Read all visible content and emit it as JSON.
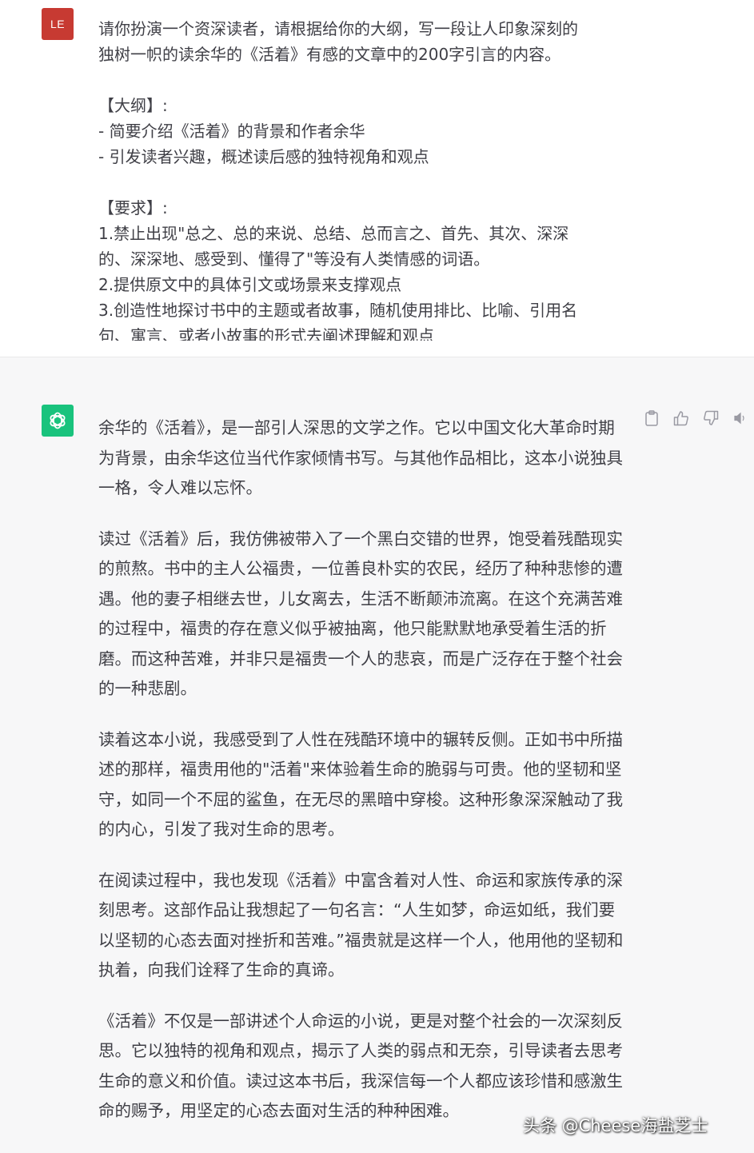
{
  "user_message": {
    "avatar_initials": "LE",
    "lines": [
      "请你扮演一个资深读者，请根据给你的大纲，写一段让人印象深刻的",
      "独树一帜的读余华的《活着》有感的文章中的200字引言的内容。",
      "",
      "【大纲】:",
      "- 简要介绍《活着》的背景和作者余华",
      "- 引发读者兴趣，概述读后感的独特视角和观点",
      "",
      "【要求】:",
      "1.禁止出现\"总之、总的来说、总结、总而言之、首先、其次、深深",
      "的、深深地、感受到、懂得了\"等没有人类情感的词语。",
      "2.提供原文中的具体引文或场景来支撑观点",
      "3.创造性地探讨书中的主题或者故事，随机使用排比、比喻、引用名",
      "句、寓言、或者小故事的形式去阐述理解和观点"
    ]
  },
  "assistant_message": {
    "avatar_icon": "openai-logo-icon",
    "paragraphs": [
      "余华的《活着》，是一部引人深思的文学之作。它以中国文化大革命时期为背景，由余华这位当代作家倾情书写。与其他作品相比，这本小说独具一格，令人难以忘怀。",
      "读过《活着》后，我仿佛被带入了一个黑白交错的世界，饱受着残酷现实的煎熬。书中的主人公福贵，一位善良朴实的农民，经历了种种悲惨的遭遇。他的妻子相继去世，儿女离去，生活不断颠沛流离。在这个充满苦难的过程中，福贵的存在意义似乎被抽离，他只能默默地承受着生活的折磨。而这种苦难，并非只是福贵一个人的悲哀，而是广泛存在于整个社会的一种悲剧。",
      "读着这本小说，我感受到了人性在残酷环境中的辗转反侧。正如书中所描述的那样，福贵用他的\"活着\"来体验着生命的脆弱与可贵。他的坚韧和坚守，如同一个不屈的鲨鱼，在无尽的黑暗中穿梭。这种形象深深触动了我的内心，引发了我对生命的思考。",
      "在阅读过程中，我也发现《活着》中富含着对人性、命运和家族传承的深刻思考。这部作品让我想起了一句名言：“人生如梦，命运如纸，我们要以坚韧的心态去面对挫折和苦难。”福贵就是这样一个人，他用他的坚韧和执着，向我们诠释了生命的真谛。",
      "《活着》不仅是一部讲述个人命运的小说，更是对整个社会的一次深刻反思。它以独特的视角和观点，揭示了人类的弱点和无奈，引导读者去思考生命的意义和价值。读过这本书后，我深信每一个人都应该珍惜和感激生命的赐予，用坚定的心态去面对生活的种种困难。"
    ],
    "actions": [
      "clipboard-icon",
      "thumbs-up-icon",
      "thumbs-down-icon",
      "speaker-icon"
    ]
  },
  "watermark": "头条 @Cheese海盐芝士",
  "colors": {
    "user_avatar": "#c73a32",
    "gpt_avatar": "#19c37d",
    "assistant_bg": "#f7f7f8",
    "text": "#3f3f46"
  }
}
